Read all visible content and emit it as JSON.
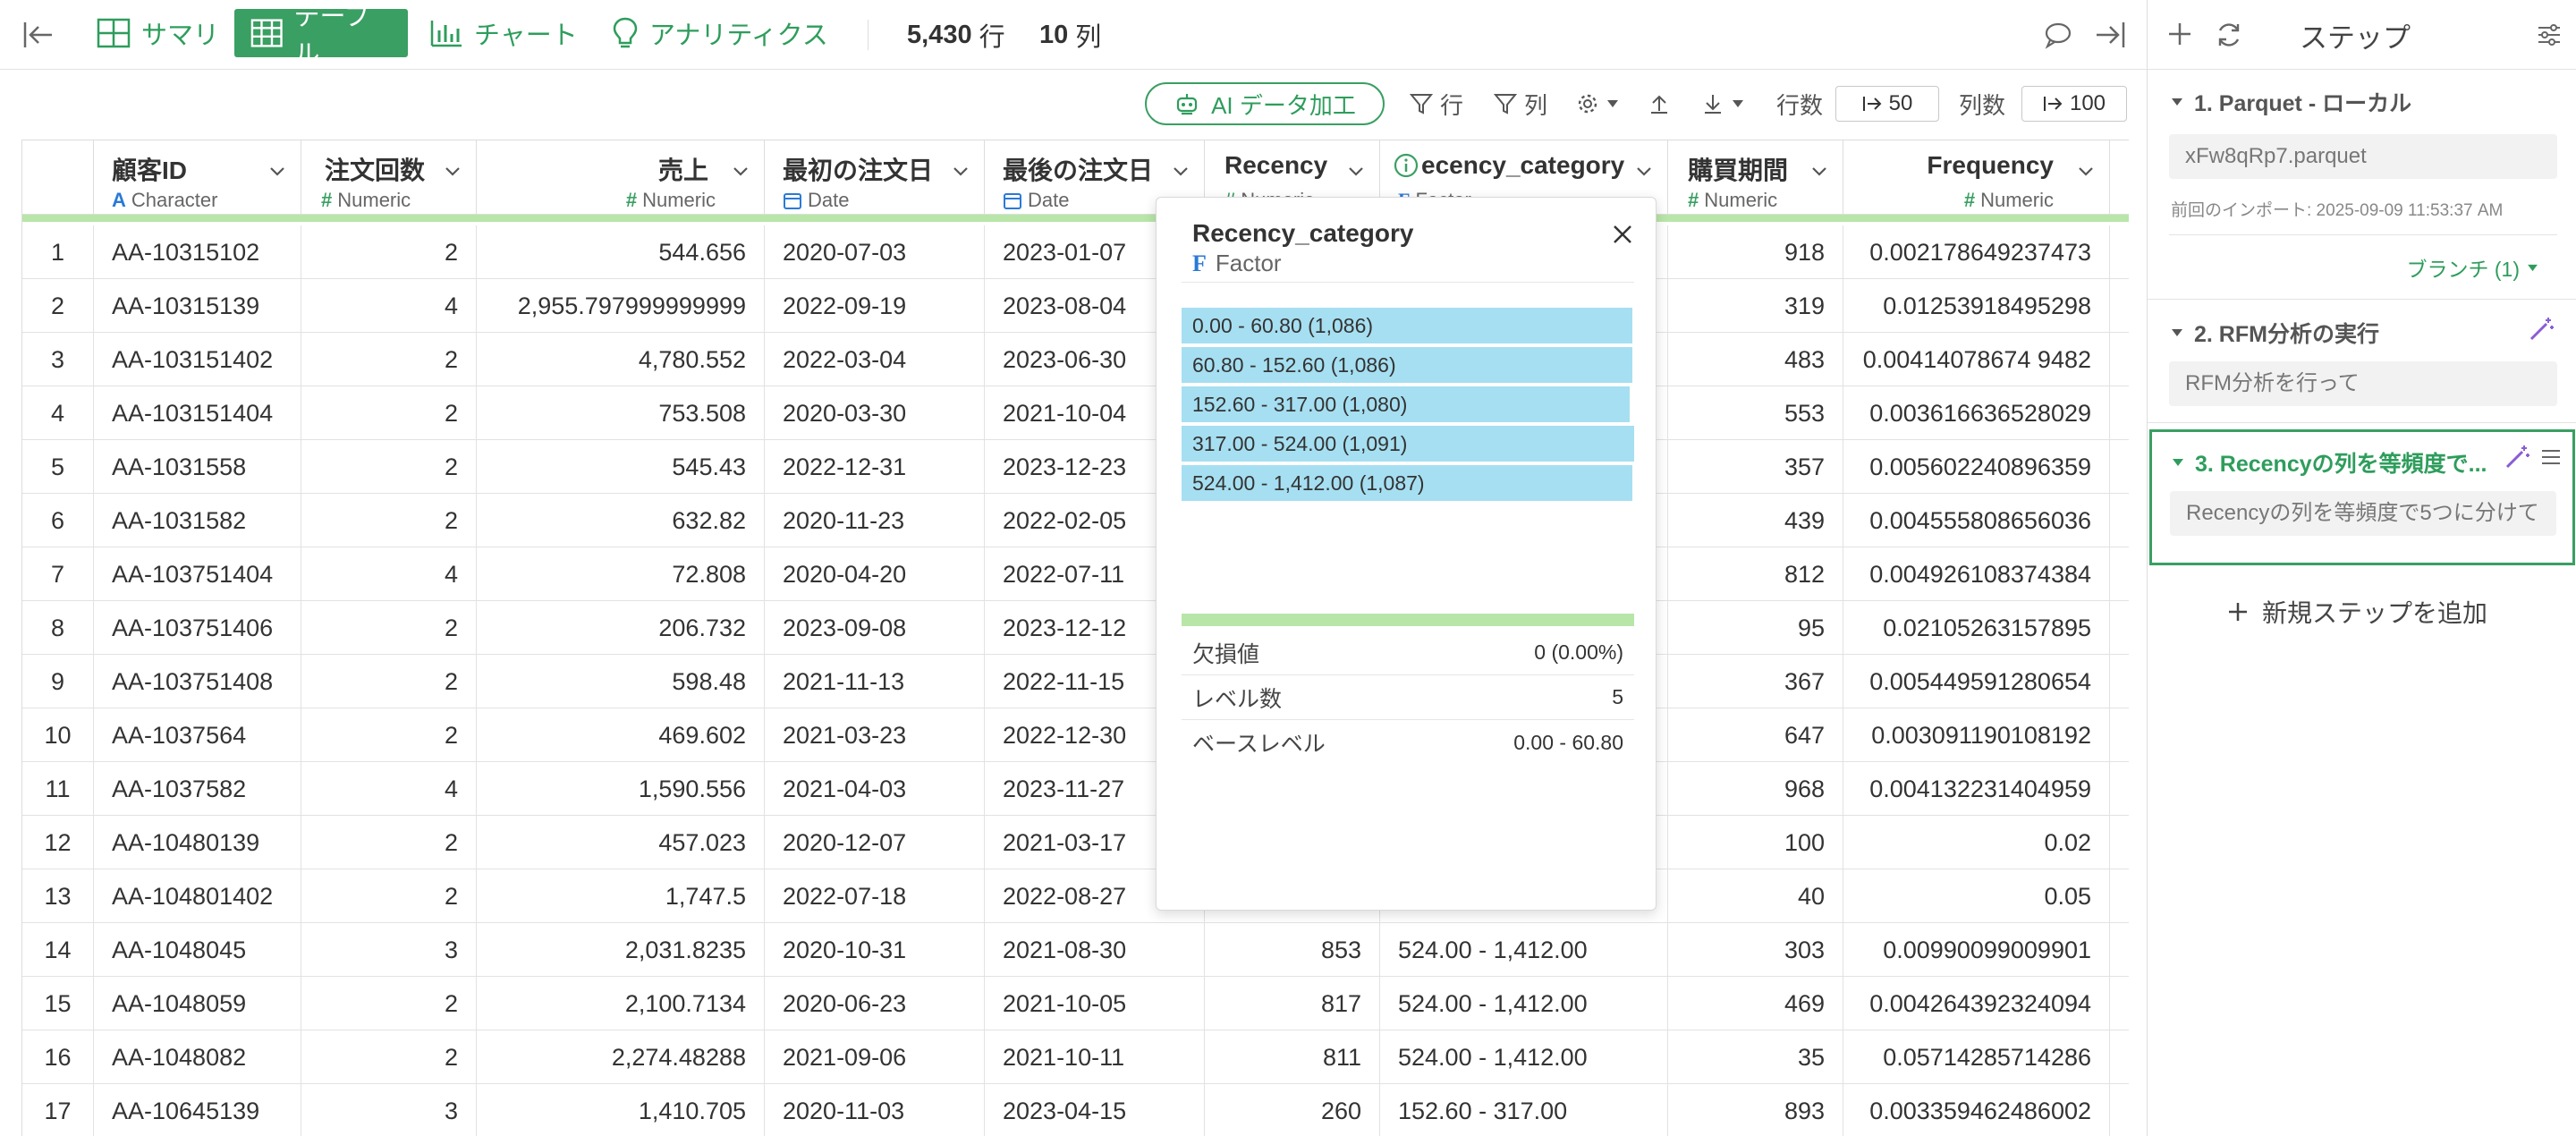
{
  "toolbar": {
    "tabs": [
      {
        "label": "サマリ"
      },
      {
        "label": "テーブル"
      },
      {
        "label": "チャート"
      },
      {
        "label": "アナリティクス"
      }
    ],
    "row_count": "5,430",
    "row_unit": "行",
    "col_count": "10",
    "col_unit": "列"
  },
  "subtoolbar": {
    "ai_label": "AI データ加工",
    "filter_row": "行",
    "filter_col": "列",
    "rows_label": "行数",
    "rows_value": "50",
    "cols_label": "列数",
    "cols_value": "100"
  },
  "columns": [
    {
      "name": "顧客ID",
      "type": "Character",
      "icon": "character-icon"
    },
    {
      "name": "注文回数",
      "type": "Numeric",
      "icon": "numeric-icon"
    },
    {
      "name": "売上",
      "type": "Numeric",
      "icon": "numeric-icon"
    },
    {
      "name": "最初の注文日",
      "type": "Date",
      "icon": "date-icon"
    },
    {
      "name": "最後の注文日",
      "type": "Date",
      "icon": "date-icon"
    },
    {
      "name": "Recency",
      "type": "Numeric",
      "icon": "numeric-icon"
    },
    {
      "name": "ecency_category",
      "type": "Factor",
      "icon": "info-icon"
    },
    {
      "name": "購買期間",
      "type": "Numeric",
      "icon": "numeric-icon"
    },
    {
      "name": "Frequency",
      "type": "Numeric",
      "icon": "numeric-icon"
    }
  ],
  "rows": [
    {
      "n": "1",
      "id": "AA-10315102",
      "orders": "2",
      "sales": "544.656",
      "first": "2020-07-03",
      "last": "2023-01-07",
      "recency": "",
      "cat": "",
      "period": "918",
      "freq": "0.002178649237473"
    },
    {
      "n": "2",
      "id": "AA-10315139",
      "orders": "4",
      "sales": "2,955.797999999999",
      "first": "2022-09-19",
      "last": "2023-08-04",
      "recency": "",
      "cat": "",
      "period": "319",
      "freq": "0.01253918495298"
    },
    {
      "n": "3",
      "id": "AA-103151402",
      "orders": "2",
      "sales": "4,780.552",
      "first": "2022-03-04",
      "last": "2023-06-30",
      "recency": "",
      "cat": "",
      "period": "483",
      "freq": "0.00414078674 9482"
    },
    {
      "n": "4",
      "id": "AA-103151404",
      "orders": "2",
      "sales": "753.508",
      "first": "2020-03-30",
      "last": "2021-10-04",
      "recency": "",
      "cat": "",
      "period": "553",
      "freq": "0.003616636528029"
    },
    {
      "n": "5",
      "id": "AA-1031558",
      "orders": "2",
      "sales": "545.43",
      "first": "2022-12-31",
      "last": "2023-12-23",
      "recency": "",
      "cat": "",
      "period": "357",
      "freq": "0.005602240896359"
    },
    {
      "n": "6",
      "id": "AA-1031582",
      "orders": "2",
      "sales": "632.82",
      "first": "2020-11-23",
      "last": "2022-02-05",
      "recency": "",
      "cat": "",
      "period": "439",
      "freq": "0.004555808656036"
    },
    {
      "n": "7",
      "id": "AA-103751404",
      "orders": "4",
      "sales": "72.808",
      "first": "2020-04-20",
      "last": "2022-07-11",
      "recency": "",
      "cat": "",
      "period": "812",
      "freq": "0.004926108374384"
    },
    {
      "n": "8",
      "id": "AA-103751406",
      "orders": "2",
      "sales": "206.732",
      "first": "2023-09-08",
      "last": "2023-12-12",
      "recency": "",
      "cat": "",
      "period": "95",
      "freq": "0.02105263157895"
    },
    {
      "n": "9",
      "id": "AA-103751408",
      "orders": "2",
      "sales": "598.48",
      "first": "2021-11-13",
      "last": "2022-11-15",
      "recency": "",
      "cat": "",
      "period": "367",
      "freq": "0.005449591280654"
    },
    {
      "n": "10",
      "id": "AA-1037564",
      "orders": "2",
      "sales": "469.602",
      "first": "2021-03-23",
      "last": "2022-12-30",
      "recency": "",
      "cat": "",
      "period": "647",
      "freq": "0.003091190108192"
    },
    {
      "n": "11",
      "id": "AA-1037582",
      "orders": "4",
      "sales": "1,590.556",
      "first": "2021-04-03",
      "last": "2023-11-27",
      "recency": "",
      "cat": "",
      "period": "968",
      "freq": "0.004132231404959"
    },
    {
      "n": "12",
      "id": "AA-10480139",
      "orders": "2",
      "sales": "457.023",
      "first": "2020-12-07",
      "last": "2021-03-17",
      "recency": "",
      "cat": "",
      "period": "100",
      "freq": "0.02"
    },
    {
      "n": "13",
      "id": "AA-104801402",
      "orders": "2",
      "sales": "1,747.5",
      "first": "2022-07-18",
      "last": "2022-08-27",
      "recency": "",
      "cat": "",
      "period": "40",
      "freq": "0.05"
    },
    {
      "n": "14",
      "id": "AA-1048045",
      "orders": "3",
      "sales": "2,031.8235",
      "first": "2020-10-31",
      "last": "2021-08-30",
      "recency": "853",
      "cat": "524.00 - 1,412.00",
      "period": "303",
      "freq": "0.00990099009901"
    },
    {
      "n": "15",
      "id": "AA-1048059",
      "orders": "2",
      "sales": "2,100.7134",
      "first": "2020-06-23",
      "last": "2021-10-05",
      "recency": "817",
      "cat": "524.00 - 1,412.00",
      "period": "469",
      "freq": "0.004264392324094"
    },
    {
      "n": "16",
      "id": "AA-1048082",
      "orders": "2",
      "sales": "2,274.48288",
      "first": "2021-09-06",
      "last": "2021-10-11",
      "recency": "811",
      "cat": "524.00 - 1,412.00",
      "period": "35",
      "freq": "0.05714285714286"
    },
    {
      "n": "17",
      "id": "AA-10645139",
      "orders": "3",
      "sales": "1,410.705",
      "first": "2020-11-03",
      "last": "2023-04-15",
      "recency": "260",
      "cat": "152.60 - 317.00",
      "period": "893",
      "freq": "0.003359462486002"
    }
  ],
  "popup": {
    "title": "Recency_category",
    "type": "Factor",
    "levels": [
      {
        "label": "0.00 - 60.80 (1,086)",
        "count": 1086
      },
      {
        "label": "60.80 - 152.60 (1,086)",
        "count": 1086
      },
      {
        "label": "152.60 - 317.00 (1,080)",
        "count": 1080
      },
      {
        "label": "317.00 - 524.00 (1,091)",
        "count": 1091
      },
      {
        "label": "524.00 - 1,412.00 (1,087)",
        "count": 1087
      }
    ],
    "stats": [
      {
        "label": "欠損値",
        "value": "0 (0.00%)"
      },
      {
        "label": "レベル数",
        "value": "5"
      },
      {
        "label": "ベースレベル",
        "value": "0.00 - 60.80"
      }
    ]
  },
  "steps_panel": {
    "title": "ステップ",
    "steps": [
      {
        "title": "1. Parquet - ローカル",
        "detail": "xFw8qRp7.parquet",
        "note": "前回のインポート: 2025-09-09 11:53:37 AM",
        "branch": "ブランチ (1)"
      },
      {
        "title": "2. RFM分析の実行",
        "detail": "RFM分析を行って"
      },
      {
        "title": "3. Recencyの列を等頻度で...",
        "detail": "Recencyの列を等頻度で5つに分けて"
      }
    ],
    "add_step": "新規ステップを追加"
  },
  "colors": {
    "accent": "#3a9f62",
    "header_bar": "#b8e6a8",
    "factor_bar": "#a6dff1"
  }
}
